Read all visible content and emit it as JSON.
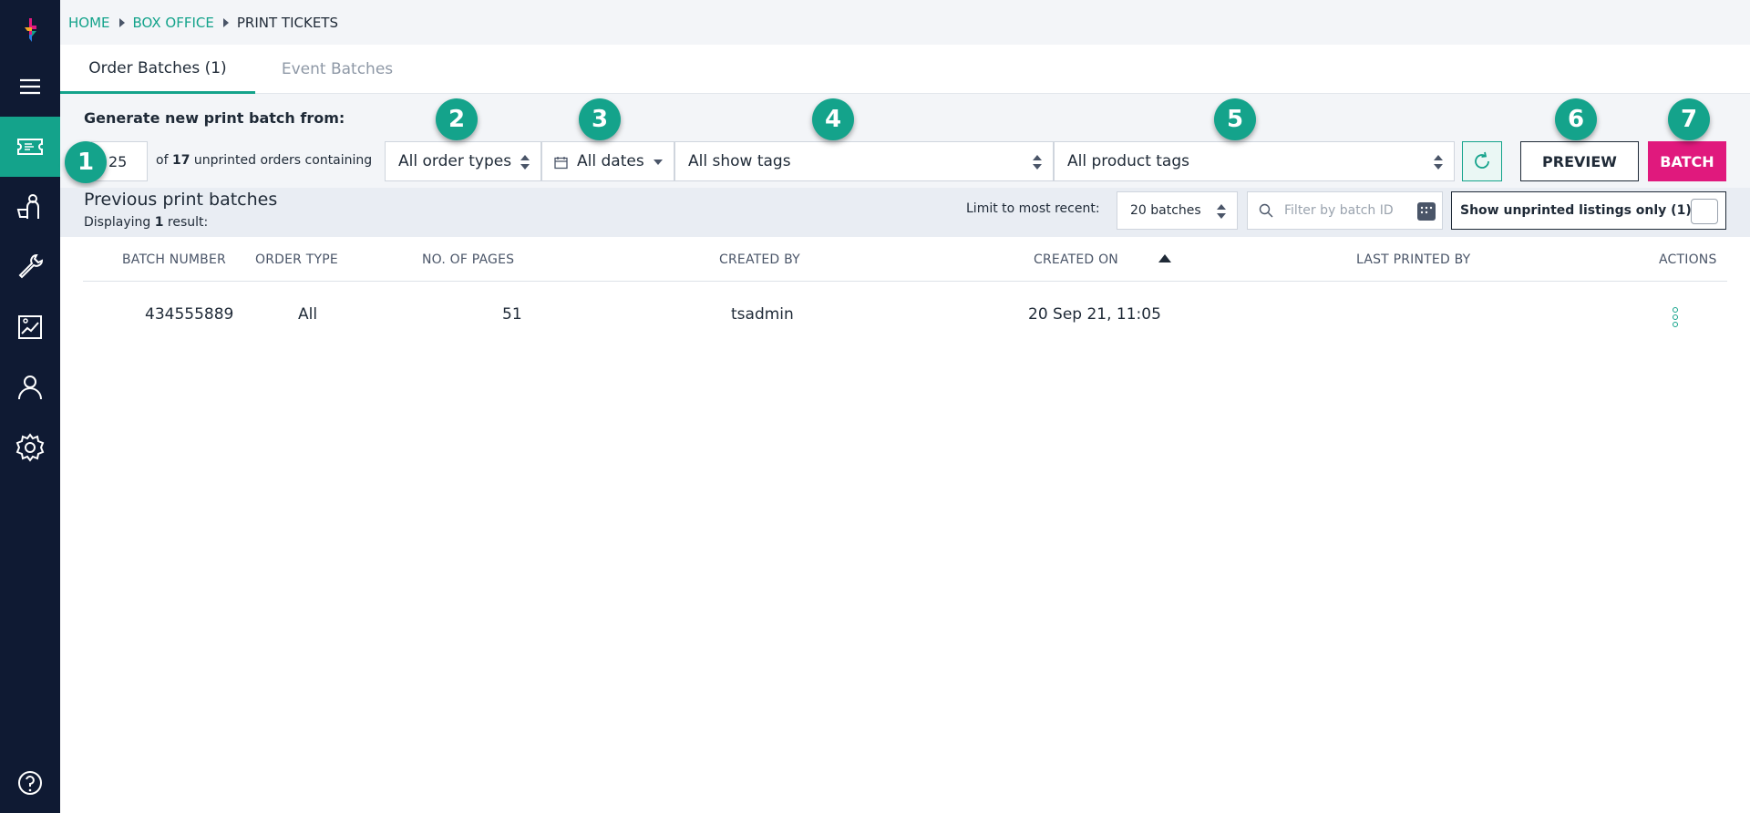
{
  "breadcrumb": {
    "home": "HOME",
    "box_office": "BOX OFFICE",
    "current": "PRINT TICKETS"
  },
  "tabs": [
    {
      "label": "Order Batches (1)",
      "active": true
    },
    {
      "label": "Event Batches",
      "active": false
    }
  ],
  "generate": {
    "title": "Generate new print batch from:",
    "count_value": "25",
    "text_prefix": "of ",
    "unprinted_count": "17",
    "text_suffix": " unprinted orders containing",
    "order_types": "All order types",
    "dates": "All dates",
    "show_tags": "All show tags",
    "product_tags": "All product tags",
    "preview_label": "PREVIEW",
    "batch_label": "BATCH"
  },
  "markers": [
    "1",
    "2",
    "3",
    "4",
    "5",
    "6",
    "7"
  ],
  "previous": {
    "title": "Previous print batches",
    "displaying_prefix": "Displaying ",
    "displaying_count": "1",
    "displaying_suffix": " result:",
    "limit_label": "Limit to most recent:",
    "limit_value": "20 batches",
    "filter_placeholder": "Filter by batch ID",
    "unprinted_label": "Show unprinted listings only (1)"
  },
  "table": {
    "columns": [
      "BATCH NUMBER",
      "ORDER TYPE",
      "NO. OF PAGES",
      "CREATED BY",
      "CREATED ON",
      "LAST PRINTED BY",
      "ACTIONS"
    ],
    "rows": [
      {
        "batch_number": "434555889",
        "order_type": "All",
        "pages": "51",
        "created_by": "tsadmin",
        "created_on": "20 Sep 21, 11:05",
        "last_printed_by": ""
      }
    ]
  },
  "colors": {
    "accent": "#14a38b",
    "sidebar": "#0f1a33",
    "batch_button": "#e0197d"
  },
  "sidebar_icons": [
    "logo-icon",
    "menu-icon",
    "ticket-icon",
    "customer-icon",
    "wrench-icon",
    "report-icon",
    "user-icon",
    "settings-icon",
    "help-icon"
  ]
}
